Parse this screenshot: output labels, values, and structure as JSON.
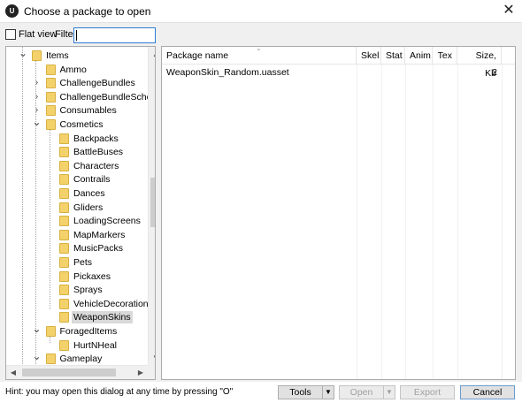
{
  "window": {
    "title": "Choose a package to open",
    "app_icon_text": "U",
    "close_glyph": "✕"
  },
  "toolbar": {
    "flat_view_label": "Flat view",
    "flat_view_checked": false,
    "filter_label": "Filter:",
    "filter_value": ""
  },
  "tree": {
    "items": [
      {
        "label": "Items",
        "level": 0,
        "expander": "expanded",
        "selected": false
      },
      {
        "label": "Ammo",
        "level": 1,
        "expander": "none",
        "selected": false
      },
      {
        "label": "ChallengeBundles",
        "level": 1,
        "expander": "collapsed",
        "selected": false
      },
      {
        "label": "ChallengeBundleSchedules",
        "level": 1,
        "expander": "collapsed",
        "selected": false
      },
      {
        "label": "Consumables",
        "level": 1,
        "expander": "collapsed",
        "selected": false
      },
      {
        "label": "Cosmetics",
        "level": 1,
        "expander": "expanded",
        "selected": false
      },
      {
        "label": "Backpacks",
        "level": 2,
        "expander": "none",
        "selected": false
      },
      {
        "label": "BattleBuses",
        "level": 2,
        "expander": "none",
        "selected": false
      },
      {
        "label": "Characters",
        "level": 2,
        "expander": "none",
        "selected": false
      },
      {
        "label": "Contrails",
        "level": 2,
        "expander": "none",
        "selected": false
      },
      {
        "label": "Dances",
        "level": 2,
        "expander": "none",
        "selected": false
      },
      {
        "label": "Gliders",
        "level": 2,
        "expander": "none",
        "selected": false
      },
      {
        "label": "LoadingScreens",
        "level": 2,
        "expander": "none",
        "selected": false
      },
      {
        "label": "MapMarkers",
        "level": 2,
        "expander": "none",
        "selected": false
      },
      {
        "label": "MusicPacks",
        "level": 2,
        "expander": "none",
        "selected": false
      },
      {
        "label": "Pets",
        "level": 2,
        "expander": "none",
        "selected": false
      },
      {
        "label": "Pickaxes",
        "level": 2,
        "expander": "none",
        "selected": false
      },
      {
        "label": "Sprays",
        "level": 2,
        "expander": "none",
        "selected": false
      },
      {
        "label": "VehicleDecorations",
        "level": 2,
        "expander": "none",
        "selected": false
      },
      {
        "label": "WeaponSkins",
        "level": 2,
        "expander": "none",
        "selected": true
      },
      {
        "label": "ForagedItems",
        "level": 1,
        "expander": "expanded",
        "selected": false
      },
      {
        "label": "HurtNHeal",
        "level": 2,
        "expander": "none",
        "selected": false
      },
      {
        "label": "Gameplay",
        "level": 1,
        "expander": "expanded",
        "selected": false
      }
    ]
  },
  "list": {
    "columns": [
      "Package name",
      "Skel",
      "Stat",
      "Anim",
      "Tex",
      "Size, Kb"
    ],
    "rows": [
      {
        "name": "WeaponSkin_Random.uasset",
        "skel": "",
        "stat": "",
        "anim": "",
        "tex": "",
        "size": "2"
      }
    ]
  },
  "footer": {
    "hint": "Hint: you may open this dialog at any time by pressing \"O\"",
    "tools_label": "Tools",
    "open_label": "Open",
    "export_label": "Export",
    "cancel_label": "Cancel",
    "dropdown_glyph": "▼"
  }
}
